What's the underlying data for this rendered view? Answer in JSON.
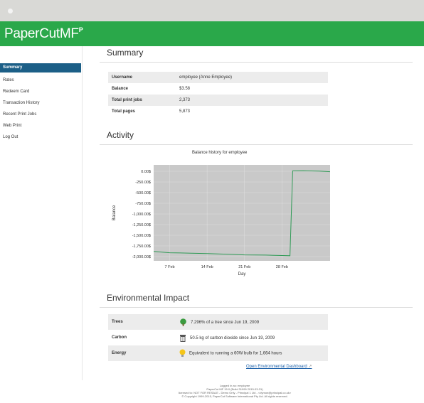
{
  "app": {
    "logo_text": "PaperCutMF",
    "logo_mark": "P"
  },
  "sidebar": {
    "items": [
      {
        "label": "Summary",
        "active": true
      },
      {
        "label": "Rates"
      },
      {
        "label": "Redeem Card"
      },
      {
        "label": "Transaction History"
      },
      {
        "label": "Recent Print Jobs"
      },
      {
        "label": "Web Print"
      },
      {
        "label": "Log Out"
      }
    ]
  },
  "summary": {
    "heading": "Summary",
    "rows": [
      {
        "label": "Username",
        "value": "employee (Anne Employee)"
      },
      {
        "label": "Balance",
        "value": "$3.58"
      },
      {
        "label": "Total print jobs",
        "value": "2,373"
      },
      {
        "label": "Total pages",
        "value": "5,873"
      }
    ]
  },
  "activity": {
    "heading": "Activity"
  },
  "chart_data": {
    "type": "line",
    "title": "Balance history for employee",
    "xlabel": "Day",
    "ylabel": "Balance",
    "x_ticks": [
      "7 Feb",
      "14 Feb",
      "21 Feb",
      "28 Feb"
    ],
    "y_ticks": [
      "0.00$",
      "-250.00$",
      "-500.00$",
      "-750.00$",
      "-1,000.00$",
      "-1,250.00$",
      "-1,500.00$",
      "-1,750.00$",
      "-2,000.00$"
    ],
    "ylim": [
      -2100,
      150
    ],
    "xlim": [
      0,
      33
    ],
    "series": [
      {
        "color": "#2e9a55",
        "points": [
          [
            0,
            -1880
          ],
          [
            3,
            -1910
          ],
          [
            7,
            -1920
          ],
          [
            10,
            -1930
          ],
          [
            14,
            -1945
          ],
          [
            17,
            -1960
          ],
          [
            21,
            -1965
          ],
          [
            24,
            -1975
          ],
          [
            25.5,
            -1980
          ],
          [
            26,
            10
          ],
          [
            28,
            12
          ],
          [
            31,
            5
          ],
          [
            33,
            -10
          ]
        ]
      }
    ],
    "grid": true,
    "background": "#c9c9c9"
  },
  "environment": {
    "heading": "Environmental Impact",
    "rows": [
      {
        "label": "Trees",
        "icon": "tree-icon",
        "value": "7.296% of a tree since Jun 19, 2009"
      },
      {
        "label": "Carbon",
        "icon": "trash-icon",
        "value": "50.5 kg of carbon dioxide since Jun 19, 2009"
      },
      {
        "label": "Energy",
        "icon": "bulb-icon",
        "value": "Equivalent to running a 60W bulb for 1,664 hours"
      }
    ],
    "dashboard_link": "Open Environmental Dashboard"
  },
  "footer": {
    "lines": [
      "Logged in as: employee",
      "PaperCut MF 15.0 (Build 31999 2015-03-31)",
      "licensed to: NOT FOR RESALE - Demo Only - Principal 1 Ltd - <dymon@principal.co.uk>",
      "© Copyright 1999-2015, PaperCut Software International Pty Ltd. All rights reserved."
    ]
  },
  "colors": {
    "brand": "#2aa84a",
    "nav_active": "#1c5f87",
    "line": "#2e9a55"
  }
}
